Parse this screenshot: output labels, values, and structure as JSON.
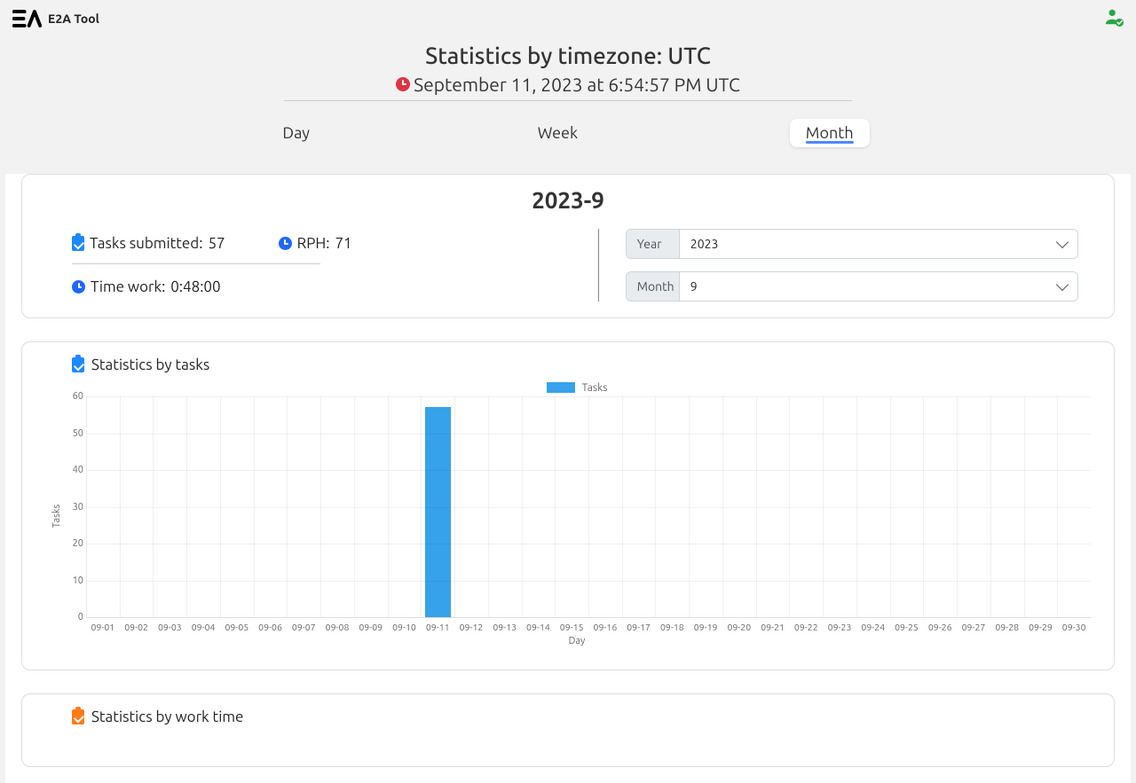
{
  "brand": {
    "name": "E2A Tool"
  },
  "header": {
    "title": "Statistics by timezone: UTC",
    "timestamp": "September 11, 2023 at 6:54:57 PM UTC"
  },
  "tabs": {
    "day": "Day",
    "week": "Week",
    "month": "Month",
    "active": "month"
  },
  "period": {
    "label": "2023-9",
    "tasks_submitted_label": "Tasks submitted:",
    "tasks_submitted_value": "57",
    "rph_label": "RPH:",
    "rph_value": "71",
    "time_work_label": "Time work:",
    "time_work_value": "0:48:00",
    "year_label": "Year",
    "year_value": "2023",
    "month_label": "Month",
    "month_value": "9"
  },
  "chart": {
    "title": "Statistics by tasks",
    "legend": "Tasks",
    "ylabel": "Tasks",
    "xlabel": "Day"
  },
  "chart2": {
    "title": "Statistics by work time"
  },
  "chart_data": {
    "type": "bar",
    "title": "Statistics by tasks",
    "xlabel": "Day",
    "ylabel": "Tasks",
    "ylim": [
      0,
      60
    ],
    "yticks": [
      0,
      10,
      20,
      30,
      40,
      50,
      60
    ],
    "categories": [
      "09-01",
      "09-02",
      "09-03",
      "09-04",
      "09-05",
      "09-06",
      "09-07",
      "09-08",
      "09-09",
      "09-10",
      "09-11",
      "09-12",
      "09-13",
      "09-14",
      "09-15",
      "09-16",
      "09-17",
      "09-18",
      "09-19",
      "09-20",
      "09-21",
      "09-22",
      "09-23",
      "09-24",
      "09-25",
      "09-26",
      "09-27",
      "09-28",
      "09-29",
      "09-30"
    ],
    "series": [
      {
        "name": "Tasks",
        "values": [
          0,
          0,
          0,
          0,
          0,
          0,
          0,
          0,
          0,
          0,
          57,
          0,
          0,
          0,
          0,
          0,
          0,
          0,
          0,
          0,
          0,
          0,
          0,
          0,
          0,
          0,
          0,
          0,
          0,
          0
        ]
      }
    ]
  }
}
